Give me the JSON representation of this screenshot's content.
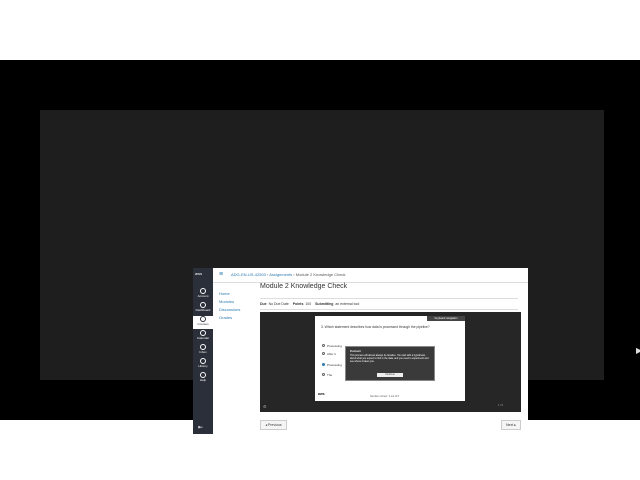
{
  "lms": {
    "logo": "aws",
    "nav": [
      {
        "label": "Account",
        "icon": "account-icon"
      },
      {
        "label": "Dashboard",
        "icon": "dashboard-icon"
      },
      {
        "label": "Courses",
        "icon": "courses-icon"
      },
      {
        "label": "Calendar",
        "icon": "calendar-icon"
      },
      {
        "label": "Inbox",
        "icon": "inbox-icon"
      },
      {
        "label": "History",
        "icon": "history-icon"
      },
      {
        "label": "Help",
        "icon": "help-icon"
      }
    ],
    "active_nav": "Courses",
    "breadcrumb": {
      "course": "ADG-EN-US-42503",
      "section": "Assignments",
      "page": "Module 2 Knowledge Check"
    },
    "course_nav": [
      "Home",
      "Modules",
      "Discussions",
      "Grades"
    ],
    "title": "Module 2 Knowledge Check",
    "meta": {
      "due_label": "Due",
      "due_value": "No Due Date",
      "points_label": "Points",
      "points_value": "100",
      "submitting_label": "Submitting",
      "submitting_value": "an external tool"
    },
    "prev_label": "◂ Previous",
    "next_label": "Next ▸"
  },
  "quiz": {
    "feedback_tab": "Keyboard navigation",
    "question": "3.  Which statement describes how data is processed through the pipeline?",
    "options": [
      "Processing",
      "After it",
      "Processing",
      "The"
    ],
    "selected_index": 2,
    "counter": "Number correct: 1 out of 5",
    "logo": "aws",
    "page": "1 / 5"
  },
  "modal": {
    "title": "Correct",
    "body": "This process will almost always be iterative. You start with a hypothesis about what you expect to find in the data, and you need to experiment and see where it takes you.",
    "button": "Continue"
  }
}
